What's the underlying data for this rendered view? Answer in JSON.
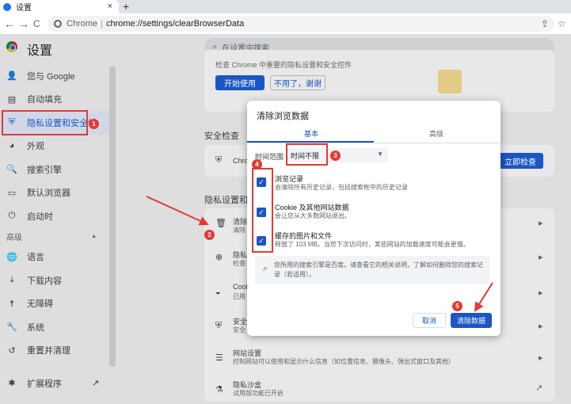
{
  "browser": {
    "tab_title": "设置",
    "tab_close": "×",
    "new_tab": "+",
    "back": "←",
    "forward": "→",
    "reload": "C",
    "url_host": "Chrome",
    "url_sep": "|",
    "url_path": "chrome://settings/clearBrowserData",
    "share": "⇪",
    "bookmark": "☆"
  },
  "settings": {
    "title": "设置",
    "search_placeholder": "在设置中搜索",
    "sidebar": [
      {
        "label": "您与 Google",
        "icon": "person-icon",
        "glyph": "👤"
      },
      {
        "label": "自动填充",
        "icon": "clipboard-icon",
        "glyph": "▤"
      },
      {
        "label": "隐私设置和安全性",
        "icon": "shield-icon",
        "glyph": "⛨"
      },
      {
        "label": "外观",
        "icon": "palette-icon",
        "glyph": "◕"
      },
      {
        "label": "搜索引擎",
        "icon": "search-icon",
        "glyph": "🔍"
      },
      {
        "label": "默认浏览器",
        "icon": "browser-icon",
        "glyph": "▭"
      },
      {
        "label": "启动时",
        "icon": "power-icon",
        "glyph": "⏻"
      }
    ],
    "advanced_label": "高级",
    "advanced_caret": "▲",
    "advanced_items": [
      {
        "label": "语言",
        "icon": "globe-icon",
        "glyph": "🌐"
      },
      {
        "label": "下载内容",
        "icon": "download-icon",
        "glyph": "⤓"
      },
      {
        "label": "无障碍",
        "icon": "accessibility-icon",
        "glyph": "☨"
      },
      {
        "label": "系统",
        "icon": "wrench-icon",
        "glyph": "🔧"
      },
      {
        "label": "重置并清理",
        "icon": "restore-icon",
        "glyph": "↺"
      }
    ],
    "extensions_label": "扩展程序",
    "extensions_ext_icon": "↗",
    "privacy_guide_text": "检查 Chrome 中重要的隐私设置和安全控件",
    "btn_start": "开始使用",
    "btn_no_thanks": "不用了，谢谢",
    "safety_check_label": "安全检查",
    "safety_row_text": "Chro",
    "btn_check_now": "立即检查",
    "privacy_section_label": "隐私设置和安全",
    "rows": [
      {
        "title": "清除",
        "sub": "清除",
        "icon": "trash-icon",
        "glyph": "🗑"
      },
      {
        "title": "隐私",
        "sub": "检查",
        "icon": "compass-icon",
        "glyph": "⊕"
      },
      {
        "title": "Cook",
        "sub": "已用",
        "icon": "cookie-icon",
        "glyph": "◒"
      },
      {
        "title": "安全",
        "sub": "安全",
        "icon": "shield-icon",
        "glyph": "⛨"
      },
      {
        "title": "网站设置",
        "sub": "控制网站可以使用和显示什么信息（如位置信息、摄像头、弹出式窗口及其他）",
        "icon": "sliders-icon",
        "glyph": "☰"
      },
      {
        "title": "隐私沙盒",
        "sub": "试用版功能已开启",
        "icon": "flask-icon",
        "glyph": "⚗"
      }
    ]
  },
  "dialog": {
    "title": "清除浏览数据",
    "tab_basic": "基本",
    "tab_advanced": "高级",
    "time_range_label": "时间范围",
    "time_range_value": "时间不限",
    "checkboxes": [
      {
        "title": "浏览记录",
        "desc": "会清除所有历史记录，包括搜索框中的历史记录",
        "checked": true
      },
      {
        "title": "Cookie 及其他网站数据",
        "desc": "会让您从大多数网站退出。",
        "checked": true
      },
      {
        "title": "缓存的图片和文件",
        "desc": "释放了 103 MB。当您下次访问时，某些网站的加载速度可能会更慢。",
        "checked": true
      }
    ],
    "info_text": "您所用的搜索引擎是百度。请查看它的相关说明，了解如何删除您的搜索记录（若适用）。",
    "btn_cancel": "取消",
    "btn_clear": "清除数据"
  },
  "annotations": [
    "1",
    "2",
    "3",
    "4",
    "5"
  ],
  "colors": {
    "accent": "#1a56c4",
    "annotation": "#e53935"
  }
}
